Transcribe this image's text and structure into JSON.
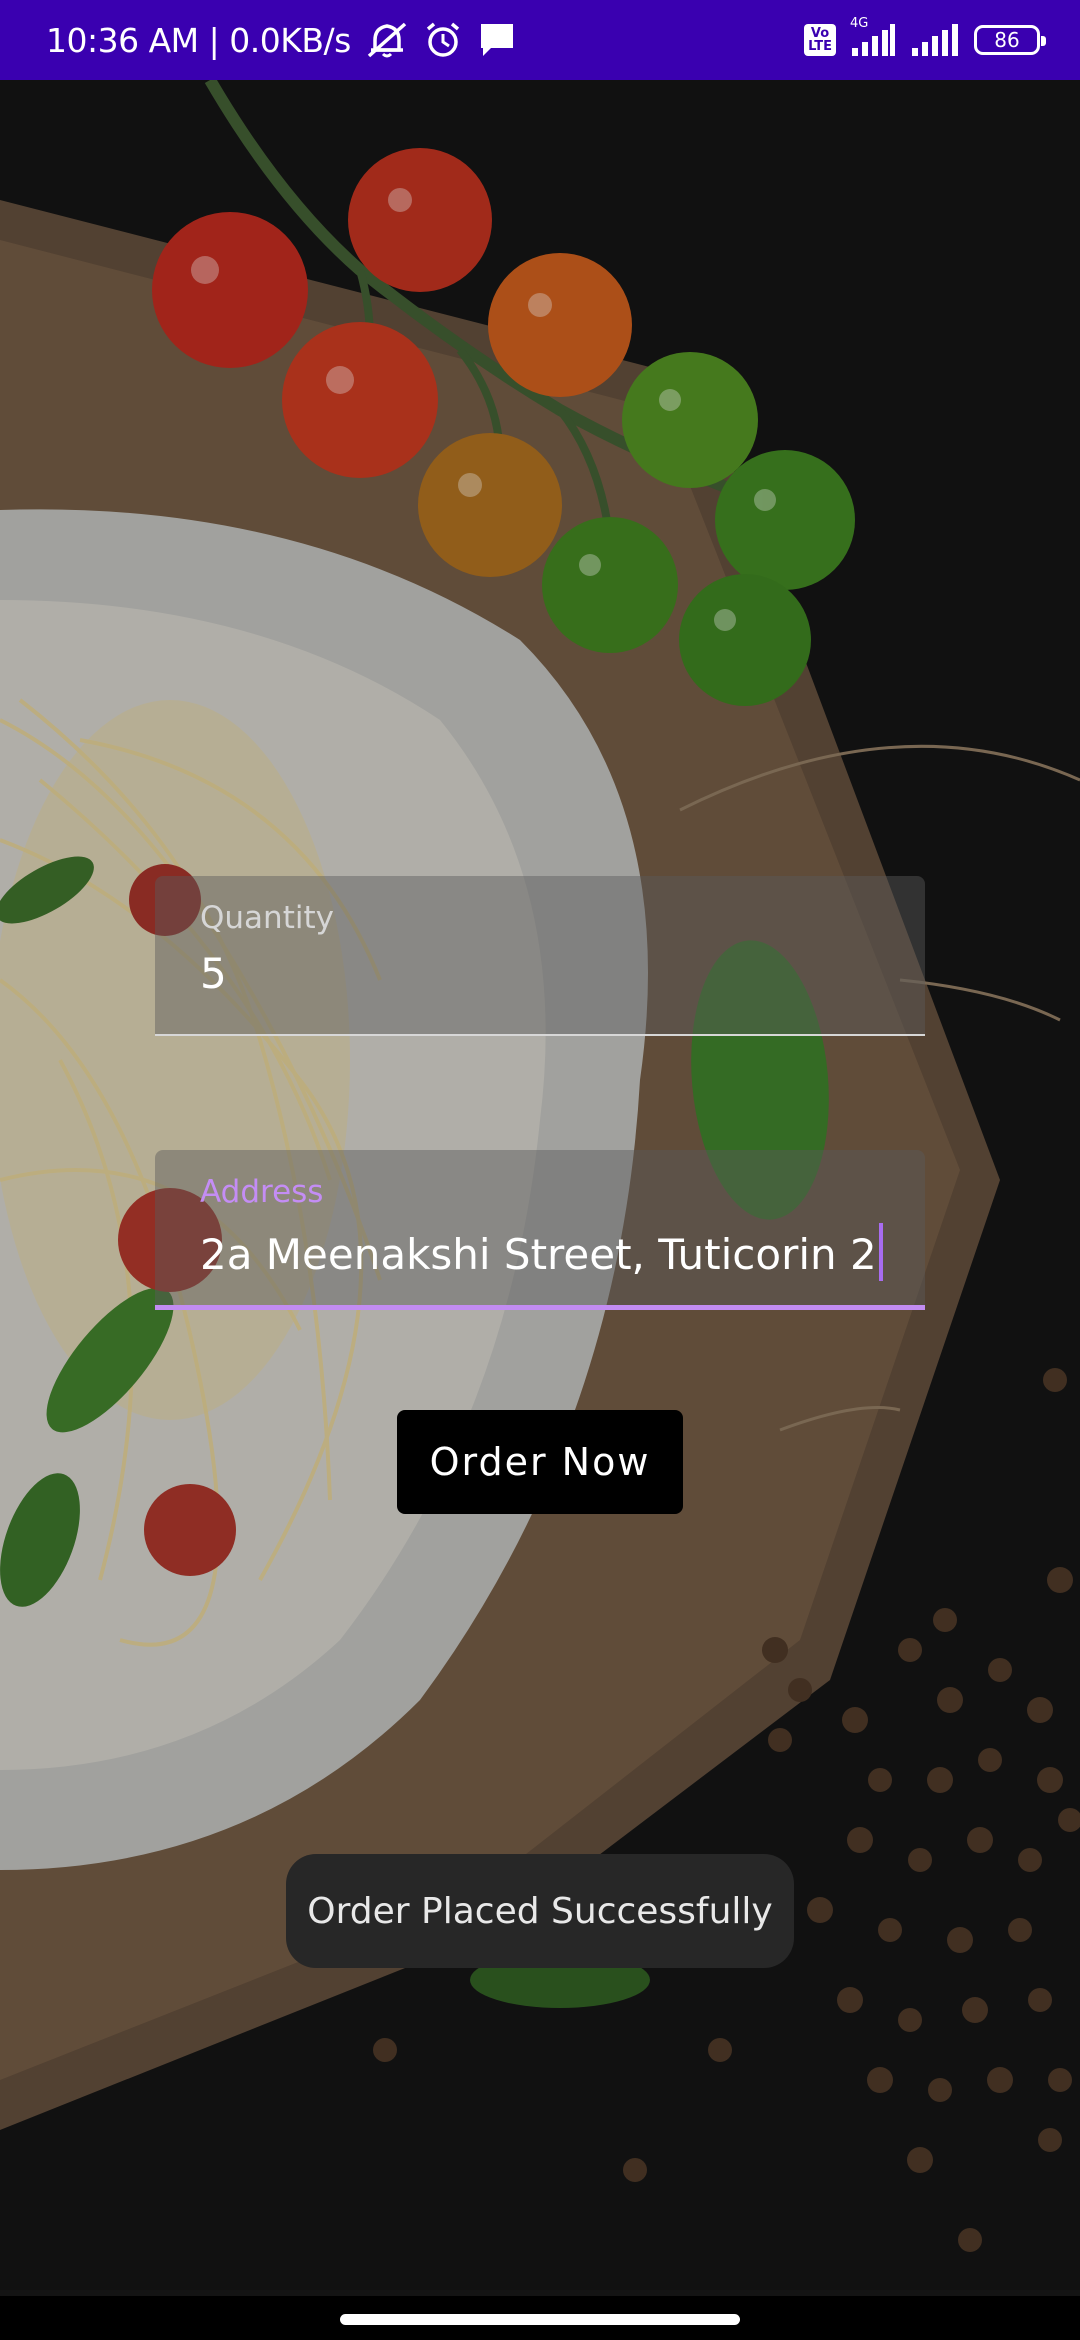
{
  "status_bar": {
    "time_speed": "10:36 AM | 0.0KB/s",
    "volte_top": "Vo",
    "volte_bottom": "LTE",
    "network": "4G",
    "battery": "86",
    "icons": [
      "mute-icon",
      "alarm-icon",
      "message-icon",
      "volte-icon",
      "signal-icon",
      "signal-icon",
      "battery-icon"
    ]
  },
  "form": {
    "quantity": {
      "label": "Quantity",
      "value": "5"
    },
    "address": {
      "label": "Address",
      "value": "2a Meenakshi Street, Tuticorin 2"
    },
    "order_button": "Order Now"
  },
  "toast": {
    "message": "Order Placed Successfully"
  },
  "colors": {
    "status_bar": "#3a00b0",
    "background": "#141414",
    "accent": "#c28cf2",
    "button": "#000000",
    "toast": "#272727"
  }
}
